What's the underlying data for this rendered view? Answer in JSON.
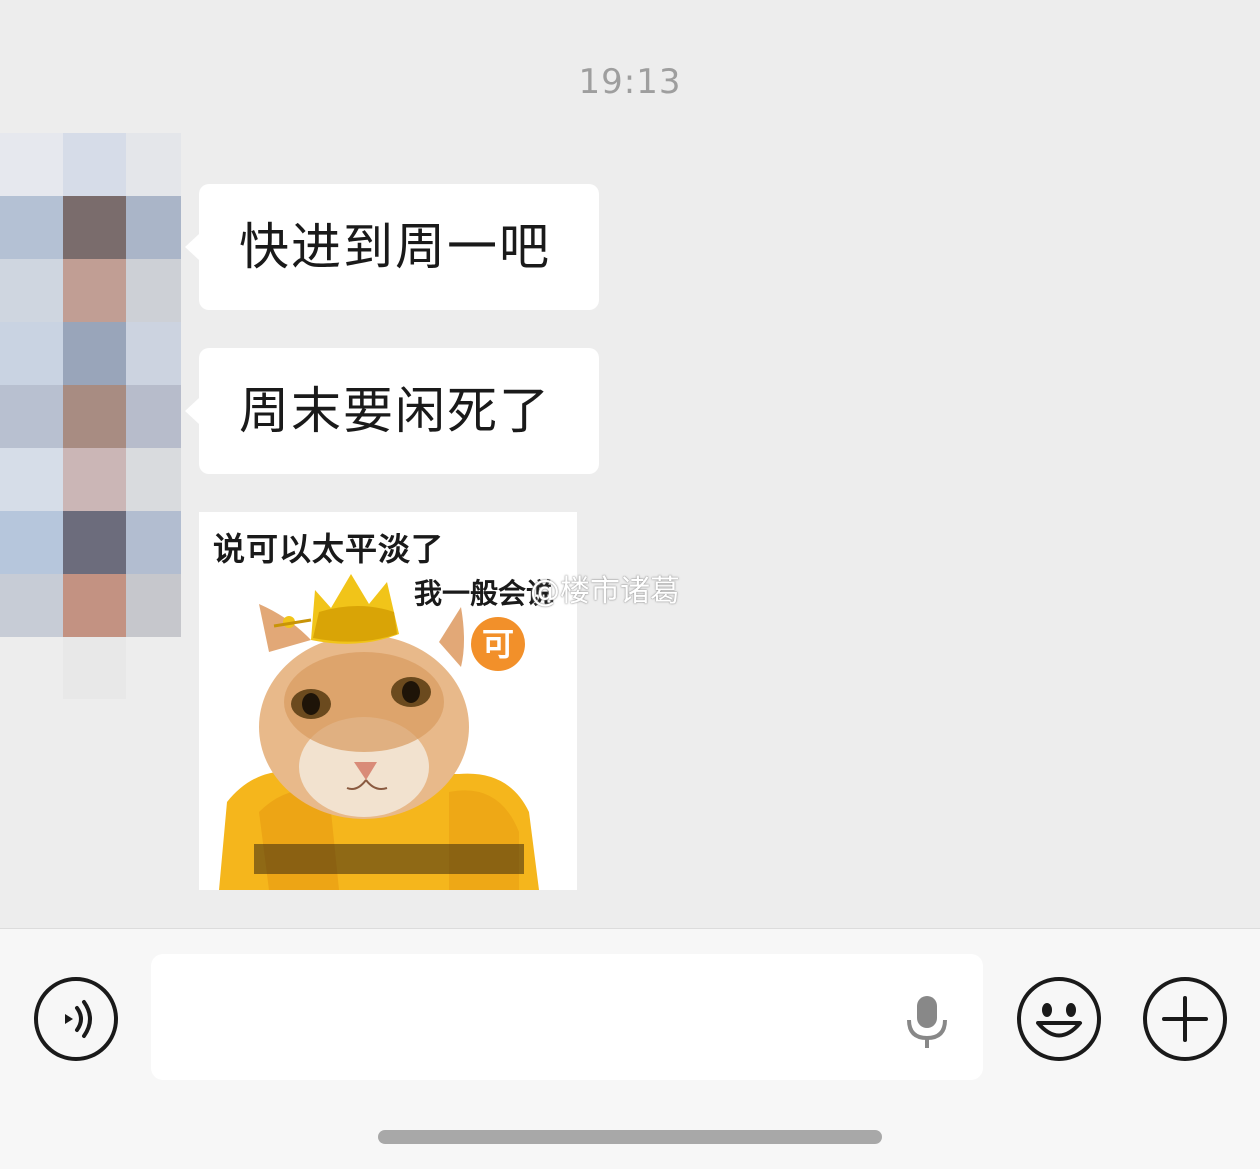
{
  "timestamp": "19:13",
  "messages": [
    {
      "type": "text",
      "text": "快进到周一吧"
    },
    {
      "type": "text",
      "text": "周末要闲死了"
    },
    {
      "type": "sticker",
      "caption_top": "说可以太平淡了",
      "caption_mid": "我一般会说",
      "badge": "可"
    }
  ],
  "watermark": "@楼市诸葛",
  "input": {
    "value": "",
    "placeholder": ""
  },
  "icons": {
    "voice": "voice-icon",
    "mic": "microphone-icon",
    "emoji": "emoji-icon",
    "plus": "plus-icon"
  },
  "colors": {
    "background": "#ededed",
    "bubble": "#ffffff",
    "badge": "#f2902a"
  }
}
